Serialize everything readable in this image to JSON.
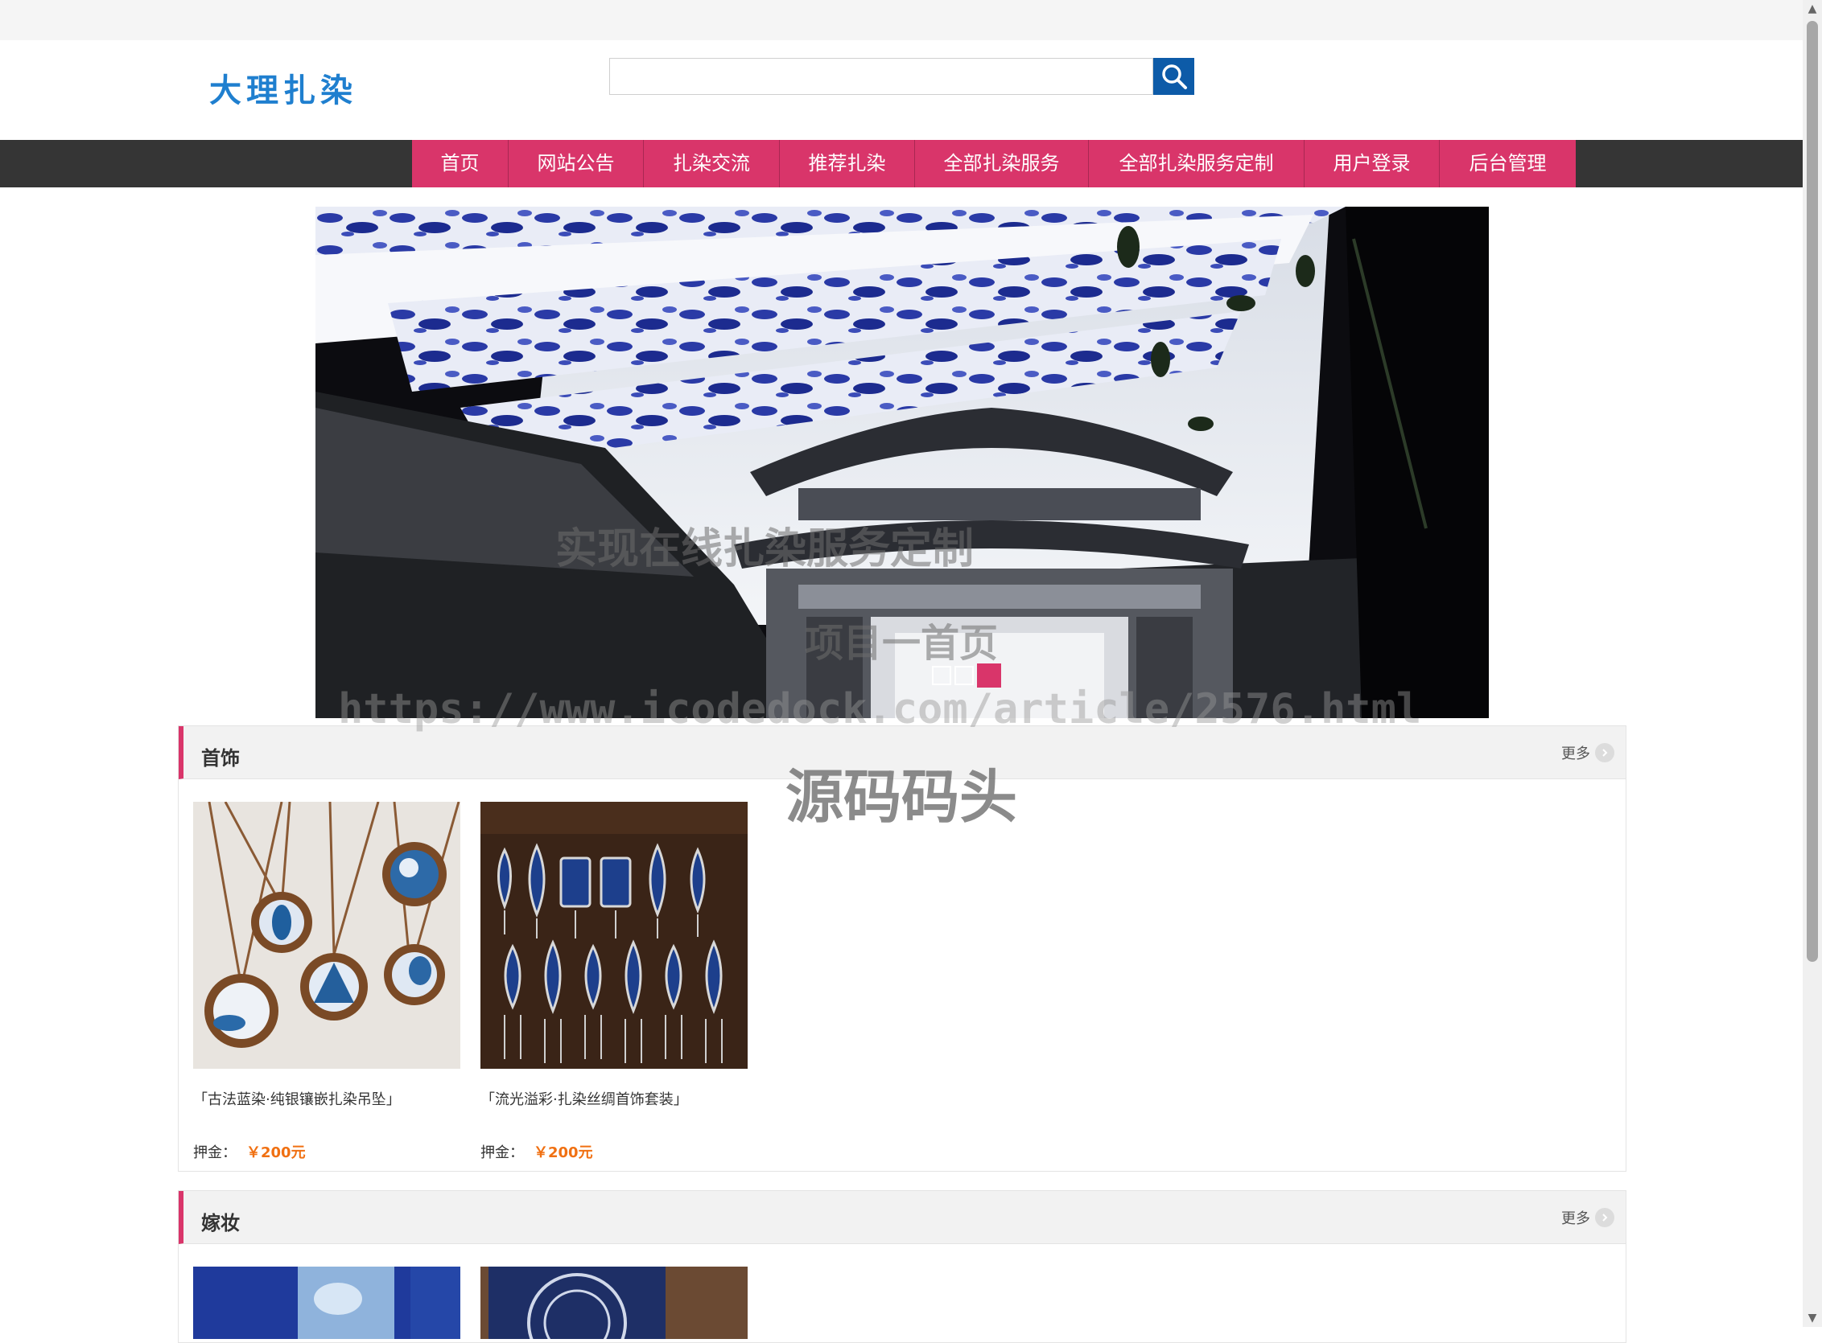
{
  "site": {
    "logo_text": "大理扎染"
  },
  "search": {
    "value": "",
    "icon": "search-icon"
  },
  "nav": {
    "items": [
      {
        "label": "首页"
      },
      {
        "label": "网站公告"
      },
      {
        "label": "扎染交流"
      },
      {
        "label": "推荐扎染"
      },
      {
        "label": "全部扎染服务"
      },
      {
        "label": "全部扎染服务定制"
      },
      {
        "label": "用户登录"
      },
      {
        "label": "后台管理"
      }
    ]
  },
  "banner": {
    "dot_count": 3,
    "active_dot": 3
  },
  "sections": [
    {
      "title": "首饰",
      "more_label": "更多",
      "items": [
        {
          "name": "「古法蓝染·纯银镶嵌扎染吊坠」",
          "price_label": "押金：",
          "price": "￥200元"
        },
        {
          "name": "「流光溢彩·扎染丝绸首饰套装」",
          "price_label": "押金：",
          "price": "￥200元"
        }
      ]
    },
    {
      "title": "嫁妆",
      "more_label": "更多",
      "items": []
    }
  ],
  "watermark": {
    "line1": "实现在线扎染服务定制",
    "line2": "项目一首页",
    "url": "https://www.icodedock.com/article/2576.html",
    "brand": "源码码头"
  },
  "colors": {
    "accent": "#d9356a",
    "nav_background": "#353535",
    "search_button": "#0d5ba8",
    "price": "#f07012",
    "logo": "#1f7fcf"
  }
}
